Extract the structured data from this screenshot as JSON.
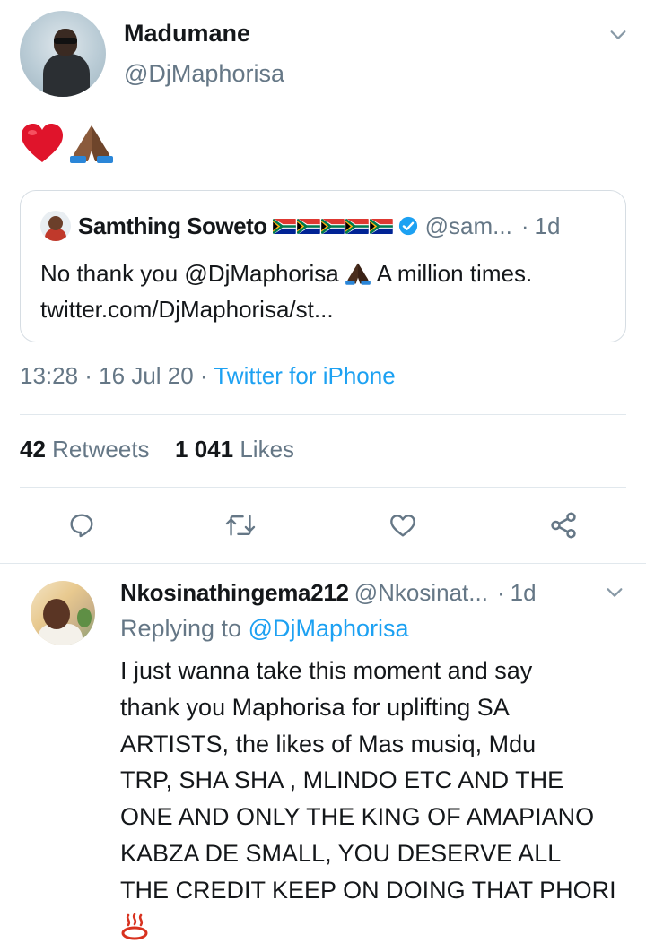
{
  "main_tweet": {
    "display_name": "Madumane",
    "handle": "@DjMaphorisa",
    "avatar": "profile-photo-man-sunglasses",
    "body_emojis": [
      "red-heart-icon",
      "folded-hands-icon"
    ],
    "quoted_tweet": {
      "author_name": "Samthing Soweto",
      "flags": [
        "south-africa-flag",
        "south-africa-flag",
        "south-africa-flag",
        "south-africa-flag",
        "south-africa-flag"
      ],
      "verified": true,
      "handle": "@sam...",
      "separator": "·",
      "time": "1d",
      "text_line_1_before": "No thank you @DjMaphorisa",
      "text_line_1_after": "A million times.",
      "text_line_2": "twitter.com/DjMaphorisa/st..."
    },
    "timestamp": "13:28 · 16 Jul 20 ·",
    "source": "Twitter for iPhone",
    "retweets_count": "42",
    "retweets_label": "Retweets",
    "likes_count": "1 041",
    "likes_label": "Likes",
    "actions": [
      "reply-icon",
      "retweet-icon",
      "like-icon",
      "share-icon"
    ]
  },
  "reply": {
    "display_name": "Nkosinathingema212",
    "handle": "@Nkosinat...",
    "separator": "·",
    "time": "1d",
    "replying_prefix": "Replying to",
    "replying_to": "@DjMaphorisa",
    "lines": [
      "I just wanna take this moment and say",
      "thank you Maphorisa for uplifting SA",
      "ARTISTS,  the likes of Mas musiq, Mdu",
      "TRP, SHA SHA , MLINDO ETC AND THE",
      "ONE AND ONLY THE KING OF AMAPIANO",
      "KABZA DE SMALL,  YOU DESERVE ALL",
      "THE CREDIT KEEP ON DOING THAT PHORI"
    ],
    "trailing_emoji": "hot-springs-icon"
  },
  "colors": {
    "text": "#14171a",
    "secondary": "#657786",
    "link": "#1da1f2",
    "divider": "#e1e8ed"
  }
}
